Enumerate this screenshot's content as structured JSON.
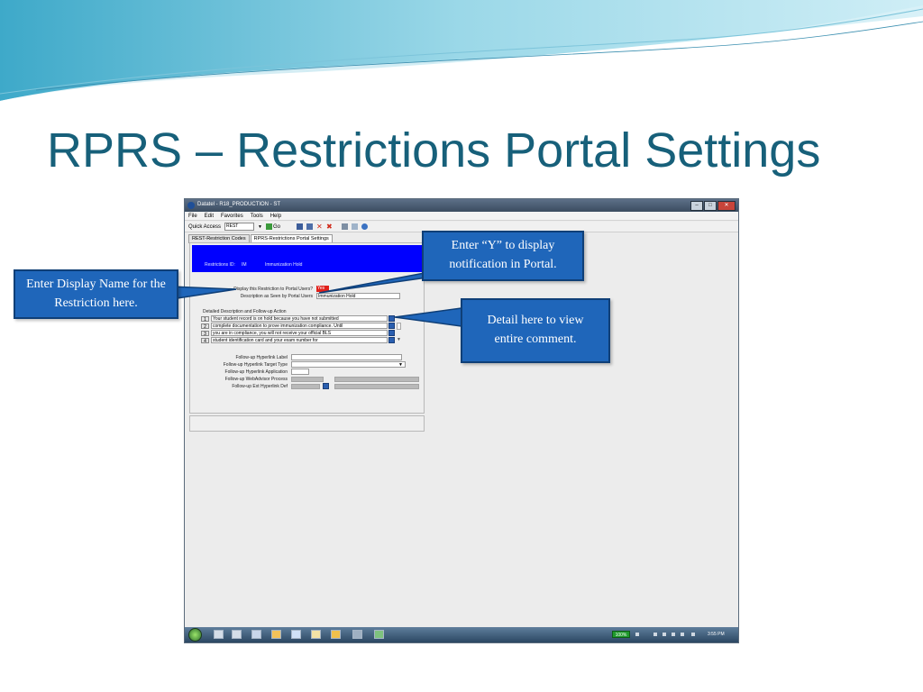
{
  "slide": {
    "title": "RPRS – Restrictions Portal Settings"
  },
  "window": {
    "title": "Datatel - R18_PRODUCTION - ST",
    "menu": [
      "File",
      "Edit",
      "Favorites",
      "Tools",
      "Help"
    ],
    "toolbar": {
      "quick_access_label": "Quick Access",
      "quick_access_value": "REST",
      "go_label": "Go"
    },
    "tabs": [
      "REST-Restriction Codes",
      "RPRS-Restrictions Portal Settings"
    ],
    "header": {
      "restriction_id_label": "Restrictions ID:",
      "restriction_code": "IM",
      "restriction_desc": "Immunization Hold"
    },
    "form": {
      "display_label": "Display this Restriction to Portal Users?",
      "display_value": "Yes",
      "desc_label": "Description as Seen by Portal Users",
      "desc_value": "Immunization Hold",
      "detail_section_label": "Detailed Description and Follow-up Action",
      "detail_rows": [
        {
          "num": "1",
          "text": "Your student record is on hold because you have not submitted"
        },
        {
          "num": "2",
          "text": "complete documentation to prove immunization compliance.  Until"
        },
        {
          "num": "3",
          "text": "you are in compliance, you will not receive your official BLS"
        },
        {
          "num": "4",
          "text": "student identification card and your exam number for"
        }
      ],
      "hyperlink_label": "Follow-up Hyperlink Label",
      "hyperlink_target_label": "Follow-up Hyperlink Target Type",
      "hyperlink_app_label": "Follow-up Hyperlink Application",
      "webadvisor_label": "Follow-up WebAdvisor Process",
      "ext_hyperlink_label": "Follow-up Ext Hyperlink Def"
    },
    "taskbar": {
      "battery": "100%",
      "clock": "3:55 PM"
    }
  },
  "callouts": {
    "display_name": "Enter Display Name for the Restriction here.",
    "enter_y": "Enter “Y” to display notification in Portal.",
    "detail": "Detail here to view entire comment."
  },
  "colors": {
    "title": "#17607a",
    "callout_fill": "#1f66ba",
    "callout_border": "#0f3f77",
    "yes_flag": "#e0201a",
    "header_band": "#0000ff"
  }
}
